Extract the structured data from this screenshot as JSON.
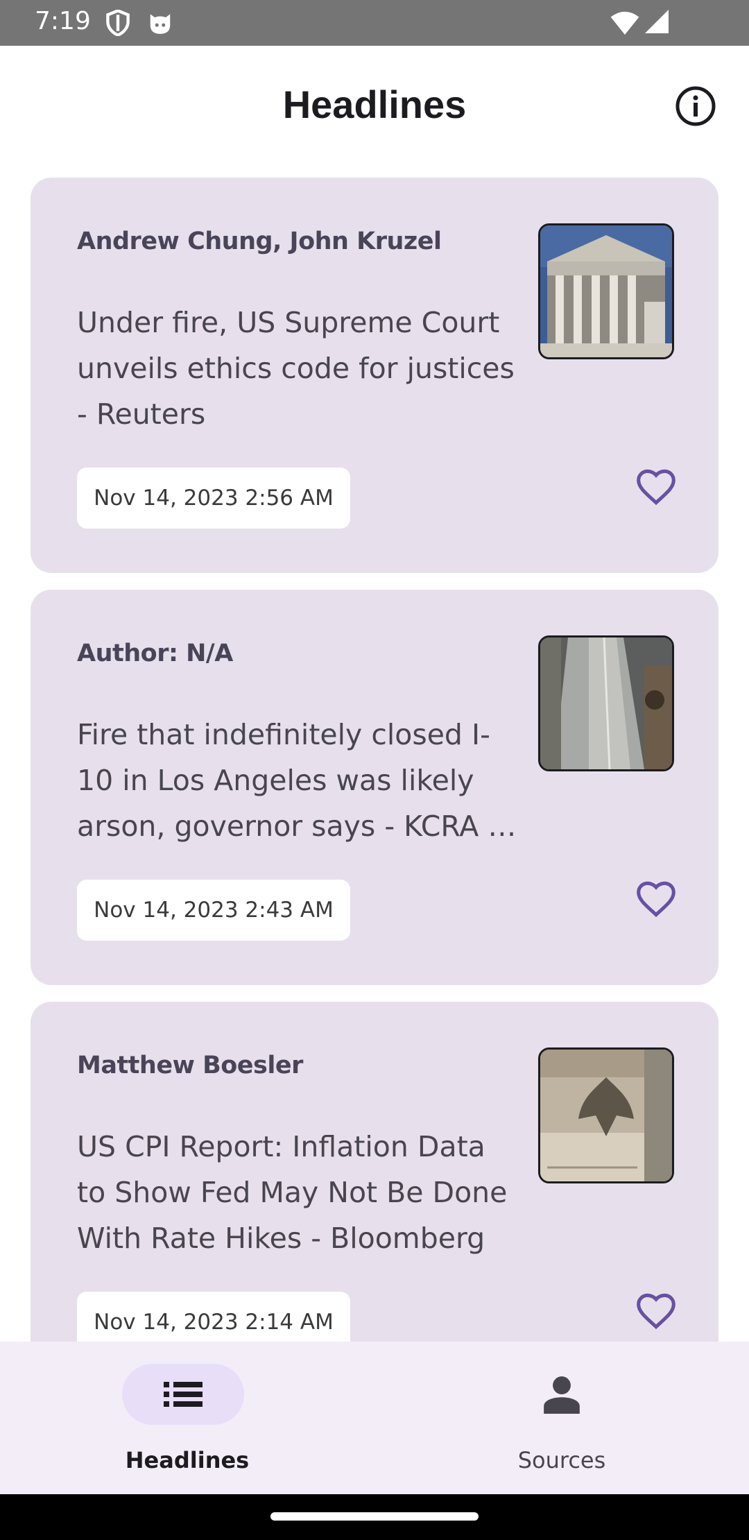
{
  "status_bar": {
    "time": "7:19",
    "left_icons": [
      "shield-icon",
      "cat-face-icon"
    ],
    "right_icons": [
      "wifi-icon",
      "cellular-signal-icon"
    ]
  },
  "header": {
    "title": "Headlines",
    "info_icon": "info-icon"
  },
  "articles": [
    {
      "author": "Andrew Chung, John Kruzel",
      "headline": "Under fire, US Supreme Court unveils ethics code for justices - Reuters",
      "date": "Nov 14, 2023 2:56 AM",
      "thumbnail": "supreme-court-building",
      "favorite_icon": "heart-outline-icon"
    },
    {
      "author": "Author: N/A",
      "headline": "Fire that indefinitely closed I-10 in Los Angeles was likely arson, governor says - KCRA …",
      "date": "Nov 14, 2023 2:43 AM",
      "thumbnail": "freeway-aerial",
      "favorite_icon": "heart-outline-icon"
    },
    {
      "author": "Matthew Boesler",
      "headline": "US CPI Report: Inflation Data to Show Fed May Not Be Done With Rate Hikes - Bloomberg",
      "date": "Nov 14, 2023 2:14 AM",
      "thumbnail": "federal-reserve-eagle",
      "favorite_icon": "heart-outline-icon"
    }
  ],
  "bottom_nav": [
    {
      "label": "Headlines",
      "icon": "list-icon",
      "active": true
    },
    {
      "label": "Sources",
      "icon": "person-icon",
      "active": false
    }
  ],
  "colors": {
    "card_bg": "#e7e0ec",
    "accent": "#6750a4",
    "nav_bg": "#f3edf7",
    "nav_active_pill": "#e8def8"
  }
}
